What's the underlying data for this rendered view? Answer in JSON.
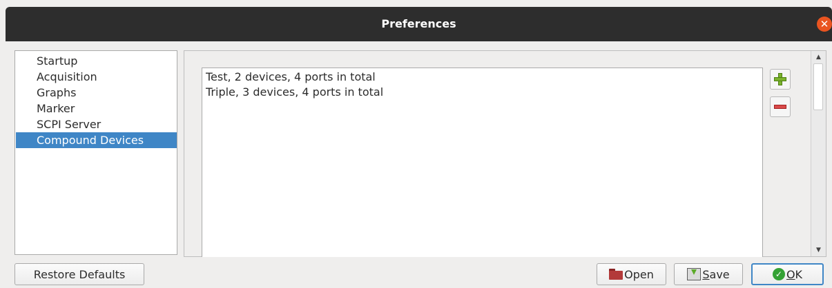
{
  "window": {
    "title": "Preferences",
    "close_glyph": "✕",
    "close_color": "#e95420"
  },
  "sidebar": {
    "items": [
      {
        "label": "Startup"
      },
      {
        "label": "Acquisition"
      },
      {
        "label": "Graphs"
      },
      {
        "label": "Marker"
      },
      {
        "label": "SCPI Server"
      },
      {
        "label": "Compound Devices",
        "selected": true
      }
    ],
    "selected_color": "#3f86c6"
  },
  "compound_devices": {
    "list": [
      {
        "label": "Test, 2 devices, 4 ports in total"
      },
      {
        "label": "Triple, 3 devices, 4 ports in total"
      }
    ],
    "add_icon": "plus-icon",
    "remove_icon": "minus-icon"
  },
  "scrollbar": {
    "up_glyph": "▲",
    "down_glyph": "▼"
  },
  "buttons": {
    "restore_defaults": "Restore Defaults",
    "open": "Open",
    "save_first": "S",
    "save_rest": "ave",
    "ok_first": "O",
    "ok_rest": "K",
    "ok_glyph": "✓"
  }
}
